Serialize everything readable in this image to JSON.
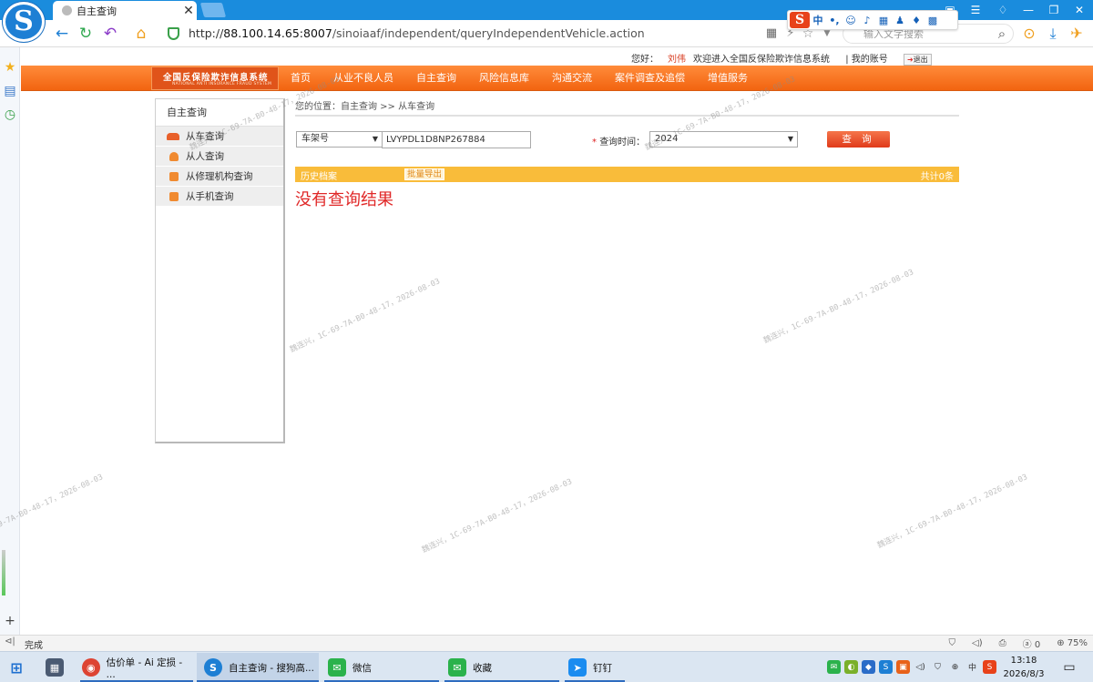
{
  "browser": {
    "tab_title": "自主查询",
    "url_scheme": "http://",
    "url_host": "88.100.14.65:8007",
    "url_path": "/sinoiaaf/independent/queryIndependentVehicle.action",
    "search_placeholder": "输入文字搜索",
    "ime_label": "中",
    "status_text": "完成",
    "zoom": "75%",
    "status_count": "0"
  },
  "site": {
    "logo_cn": "全国反保险欺诈信息系统",
    "logo_en": "NATIONAL ANTI INSURANCE FRAUD SYSTEM",
    "greeting": "您好：",
    "user_name": "刘伟",
    "welcome": "欢迎进入全国反保险欺诈信息系统",
    "my_account": "| 我的账号",
    "logout": "退出",
    "nav": [
      "首页",
      "从业不良人员",
      "自主查询",
      "风险信息库",
      "沟通交流",
      "案件调查及追偿",
      "增值服务"
    ]
  },
  "menu": {
    "title": "自主查询",
    "items": [
      "从车查询",
      "从人查询",
      "从修理机构查询",
      "从手机查询"
    ]
  },
  "content": {
    "breadcrumb": "您的位置：自主查询 >> 从车查询",
    "type_select": "车架号",
    "vin_value": "LVYPDL1D8NP267884",
    "time_label": "查询时间：",
    "time_required": "*",
    "year_select": "2024",
    "query_button": "查 询",
    "history_label": "历史档案",
    "export_label": "批量导出",
    "count_label": "共计0条",
    "no_result": "没有查询结果"
  },
  "watermark": "魏连兴，1C-69-7A-B0-48-17，2026-08-03",
  "taskbar": {
    "tasks": [
      "估价单 - Ai 定损 - ...",
      "自主查询 - 搜狗高...",
      "微信",
      "收藏",
      "钉钉"
    ],
    "time": "13:18",
    "date": "2026/8/3"
  }
}
